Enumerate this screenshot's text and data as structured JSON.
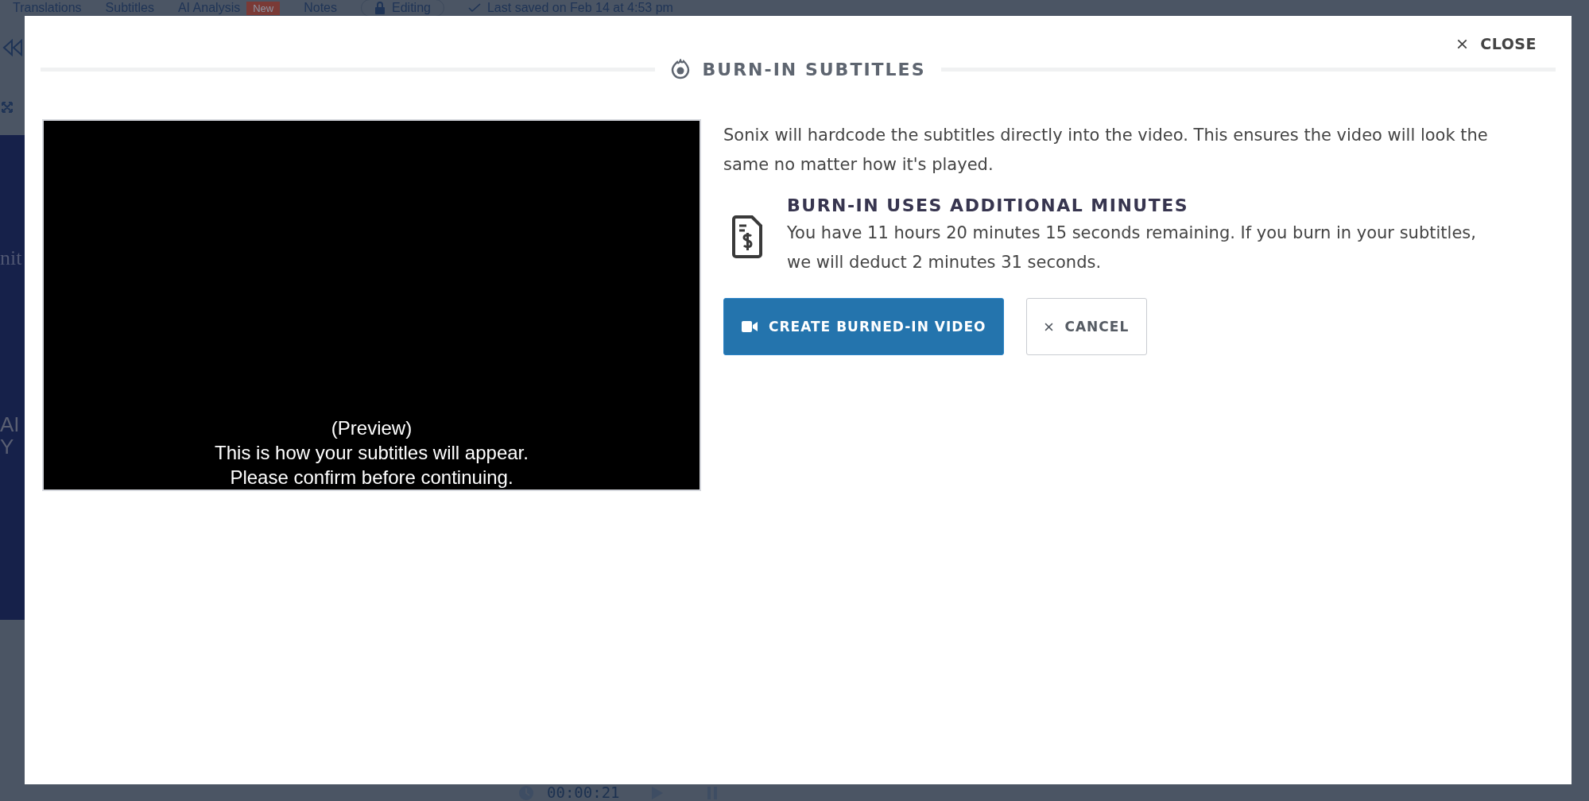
{
  "background": {
    "tabs": [
      {
        "label": "Translations"
      },
      {
        "label": "Subtitles"
      },
      {
        "label": "AI Analysis",
        "badge": "New"
      },
      {
        "label": "Notes"
      }
    ],
    "editing": "Editing",
    "last_saved": "Last saved on Feb 14 at 4:53 pm",
    "side_fragments": [
      "nit",
      "AI",
      "Y"
    ],
    "timer": "00:00:21"
  },
  "modal": {
    "close": "CLOSE",
    "title": "BURN-IN SUBTITLES",
    "preview_lines": [
      "(Preview)",
      "This is how your subtitles will appear.",
      "Please confirm before continuing."
    ],
    "description": "Sonix will hardcode the subtitles directly into the video. This ensures the video will look the same no matter how it's played.",
    "notice": {
      "heading": "BURN-IN USES ADDITIONAL MINUTES",
      "text": "You have 11 hours 20 minutes 15 seconds remaining. If you burn in your subtitles, we will deduct 2 minutes 31 seconds."
    },
    "buttons": [
      {
        "label": "CREATE BURNED-IN VIDEO",
        "kind": "primary"
      },
      {
        "label": "CANCEL",
        "kind": "secondary"
      }
    ]
  }
}
